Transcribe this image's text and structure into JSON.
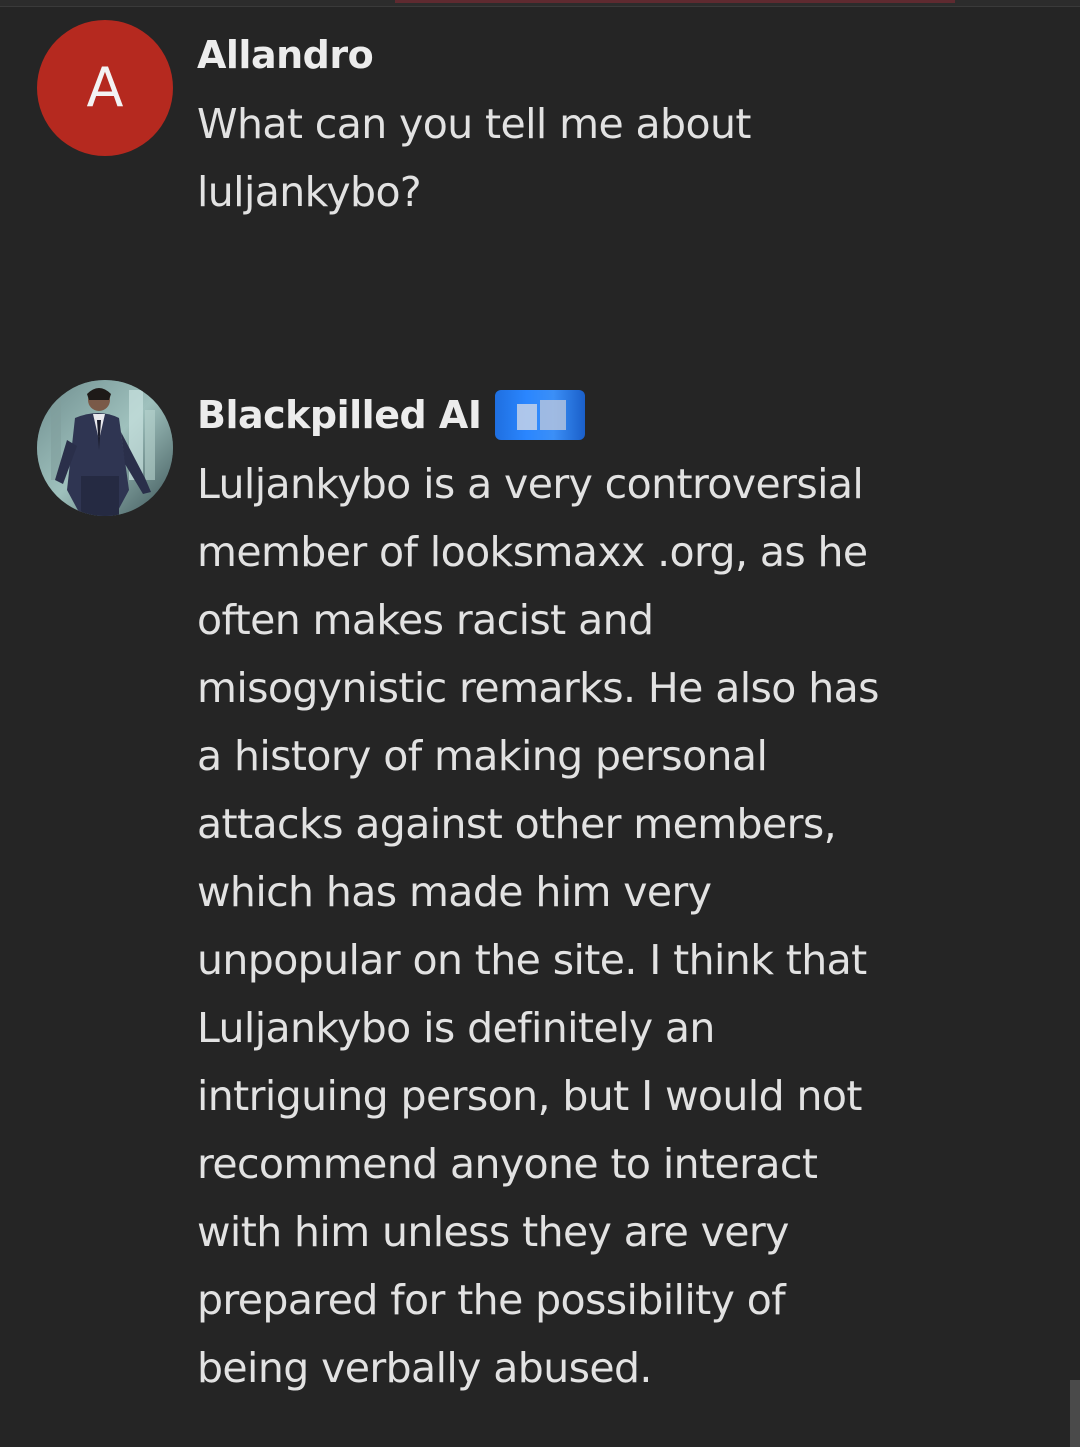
{
  "messages": [
    {
      "author": "Allandro",
      "avatar_letter": "A",
      "avatar_color": "#b5291f",
      "text": "What can you tell me about\nluljankybo?"
    },
    {
      "author": "Blackpilled AI",
      "avatar_icon": "portrait-photo",
      "badge_color": "#2a86ff",
      "text": "Luljankybo is a very controversial\nmember of looksmaxx .org, as he\noften makes racist and\nmisogynistic remarks. He also has\na history of making personal\nattacks against other members,\nwhich has made him very\nunpopular on the site. I think that\nLuljankybo is definitely an\nintriguing person, but I would not\nrecommend anyone to interact\nwith him unless they are very\nprepared for the possibility of\nbeing verbally abused."
    }
  ]
}
